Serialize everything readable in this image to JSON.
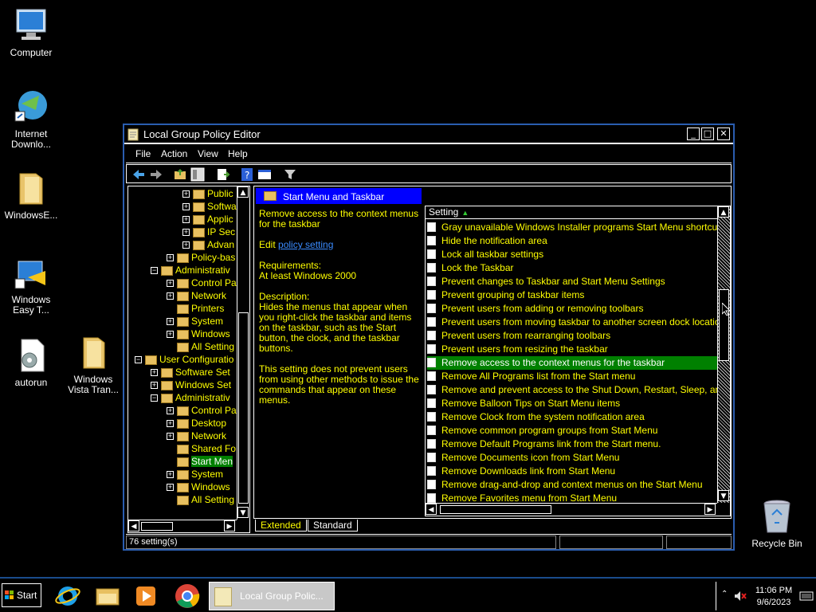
{
  "desktop": {
    "icons": [
      {
        "label": "Computer"
      },
      {
        "label": "Internet Downlo..."
      },
      {
        "label": "WindowsE..."
      },
      {
        "label": "Windows Easy T..."
      },
      {
        "label": "autorun"
      },
      {
        "label": "Windows Vista Tran..."
      },
      {
        "label": "Recycle Bin"
      }
    ]
  },
  "window": {
    "title": "Local Group Policy Editor",
    "menu": [
      "File",
      "Action",
      "View",
      "Help"
    ],
    "tree": [
      {
        "label": "Public",
        "exp": "+"
      },
      {
        "label": "Softwa",
        "exp": "+"
      },
      {
        "label": "Applic",
        "exp": "+"
      },
      {
        "label": "IP Sec",
        "exp": "+"
      },
      {
        "label": "Advan",
        "exp": "+"
      },
      {
        "label": "Policy-bas",
        "exp": "+"
      },
      {
        "label": "Administrativ",
        "exp": "−"
      },
      {
        "label": "Control Pa",
        "exp": "+"
      },
      {
        "label": "Network",
        "exp": "+"
      },
      {
        "label": "Printers",
        "exp": ""
      },
      {
        "label": "System",
        "exp": "+"
      },
      {
        "label": "Windows",
        "exp": "+"
      },
      {
        "label": "All Setting",
        "exp": ""
      },
      {
        "label": "User Configuratio",
        "exp": "−"
      },
      {
        "label": "Software Set",
        "exp": "+"
      },
      {
        "label": "Windows Set",
        "exp": "+"
      },
      {
        "label": "Administrativ",
        "exp": "−"
      },
      {
        "label": "Control Pa",
        "exp": "+"
      },
      {
        "label": "Desktop",
        "exp": "+"
      },
      {
        "label": "Network",
        "exp": "+"
      },
      {
        "label": "Shared Fo",
        "exp": ""
      },
      {
        "label": "Start Men",
        "exp": ""
      },
      {
        "label": "System",
        "exp": "+"
      },
      {
        "label": "Windows",
        "exp": "+"
      },
      {
        "label": "All Setting",
        "exp": ""
      }
    ],
    "section_title": "Start Menu and Taskbar",
    "description": {
      "heading": "Remove access to the context menus for the taskbar",
      "edit_prefix": "Edit",
      "edit_link": "policy setting",
      "req_label": "Requirements:",
      "req_value": "At least Windows 2000",
      "desc_label": "Description:",
      "desc_text": "Hides the menus that appear when you right-click the taskbar and items on the taskbar, such as the Start button, the clock, and the taskbar buttons.",
      "desc_text2": "This setting does not prevent users from using other methods to issue the commands that appear on these menus."
    },
    "list_header": "Setting",
    "settings": [
      "Gray unavailable Windows Installer programs Start Menu shortcuts",
      "Hide the notification area",
      "Lock all taskbar settings",
      "Lock the Taskbar",
      "Prevent changes to Taskbar and Start Menu Settings",
      "Prevent grouping of taskbar items",
      "Prevent users from adding or removing toolbars",
      "Prevent users from moving taskbar to another screen dock location",
      "Prevent users from rearranging toolbars",
      "Prevent users from resizing the taskbar",
      "Remove access to the context menus for the taskbar",
      "Remove All Programs list from the Start menu",
      "Remove and prevent access to the Shut Down, Restart, Sleep, and Hibernate commands",
      "Remove Balloon Tips on Start Menu items",
      "Remove Clock from the system notification area",
      "Remove common program groups from Start Menu",
      "Remove Default Programs link from the Start menu.",
      "Remove Documents icon from Start Menu",
      "Remove Downloads link from Start Menu",
      "Remove drag-and-drop and context menus on the Start Menu",
      "Remove Favorites menu from Start Menu"
    ],
    "selected_index": 10,
    "tabs": [
      "Extended",
      "Standard"
    ],
    "status": "76 setting(s)"
  },
  "taskbar": {
    "start_label": "Start",
    "active_task": "Local Group Polic...",
    "time": "11:06 PM",
    "date": "9/6/2023"
  },
  "colors": {
    "text_yellow": "#ffff00",
    "select_green": "#008000",
    "header_blue": "#0000ff",
    "link_blue": "#3a8bff"
  }
}
